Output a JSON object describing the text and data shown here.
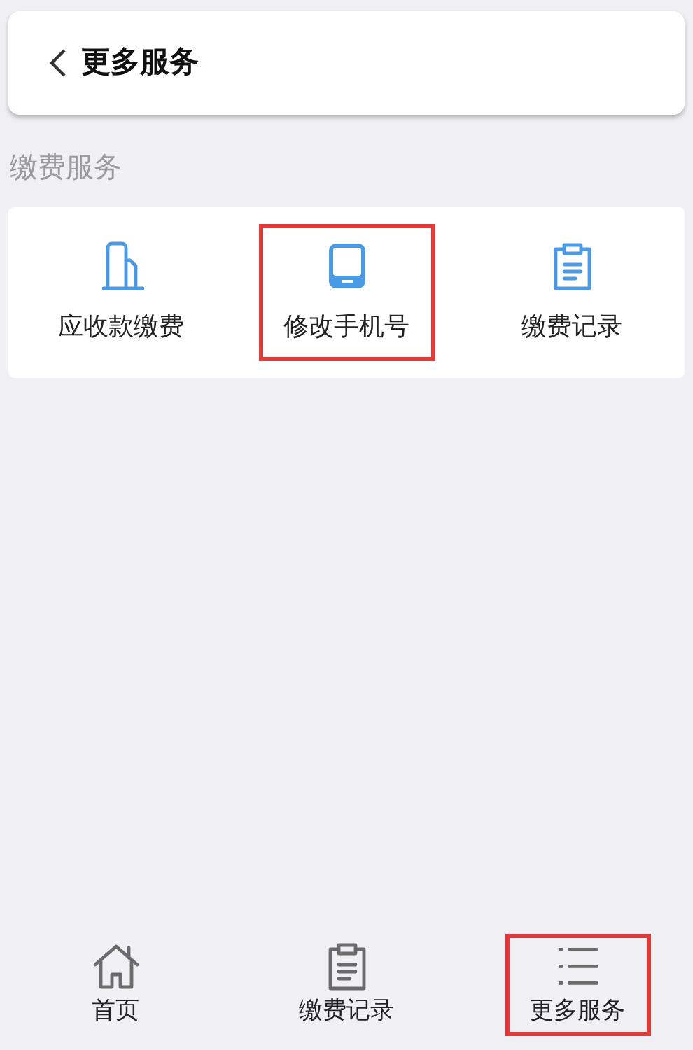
{
  "header": {
    "title": "更多服务"
  },
  "section": {
    "title": "缴费服务"
  },
  "services": [
    {
      "kind": "building",
      "label": "应收款缴费",
      "highlighted": false
    },
    {
      "kind": "phone",
      "label": "修改手机号",
      "highlighted": true
    },
    {
      "kind": "clipboard",
      "label": "缴费记录",
      "highlighted": false
    }
  ],
  "tabs": [
    {
      "kind": "home",
      "label": "首页",
      "highlighted": false
    },
    {
      "kind": "clipboard",
      "label": "缴费记录",
      "highlighted": false
    },
    {
      "kind": "list",
      "label": "更多服务",
      "highlighted": true
    }
  ]
}
